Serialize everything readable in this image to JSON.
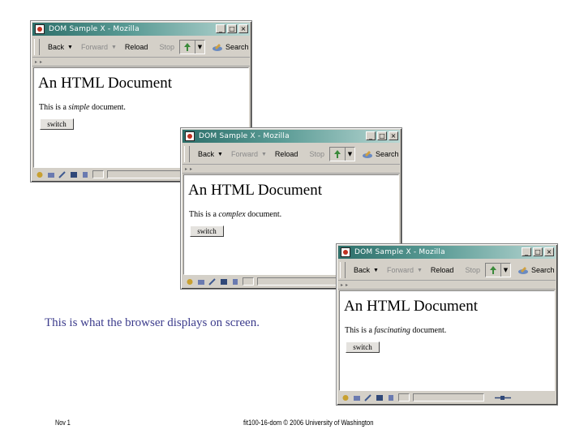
{
  "windows": [
    {
      "title": "DOM Sample X - Mozilla",
      "nav": {
        "back": "Back",
        "forward": "Forward",
        "reload": "Reload",
        "stop": "Stop",
        "search": "Search"
      },
      "heading": "An HTML Document",
      "text_before": "This is a ",
      "emphasis": "simple",
      "text_after": " document.",
      "button_label": "switch"
    },
    {
      "title": "DOM Sample X - Mozilla",
      "nav": {
        "back": "Back",
        "forward": "Forward",
        "reload": "Reload",
        "stop": "Stop",
        "search": "Search"
      },
      "heading": "An HTML Document",
      "text_before": "This is a ",
      "emphasis": "complex",
      "text_after": " document.",
      "button_label": "switch"
    },
    {
      "title": "DOM Sample X - Mozilla",
      "nav": {
        "back": "Back",
        "forward": "Forward",
        "reload": "Reload",
        "stop": "Stop",
        "search": "Search"
      },
      "heading": "An HTML Document",
      "text_before": "This is a ",
      "emphasis": "fascinating",
      "text_after": " document.",
      "button_label": "switch"
    }
  ],
  "caption": "This is what the browser displays on screen.",
  "footer": {
    "date": "Nov 1",
    "center": "fit100-16-dom © 2006 University of Washington"
  },
  "colors": {
    "titlebar_start": "#2d6f6a",
    "caption": "#3c3c8c",
    "chrome": "#d4d0c8"
  },
  "icons": [
    "app-icon",
    "minimize-icon",
    "maximize-icon",
    "close-icon",
    "dropdown-arrow-icon",
    "search-icon",
    "status-icons"
  ]
}
